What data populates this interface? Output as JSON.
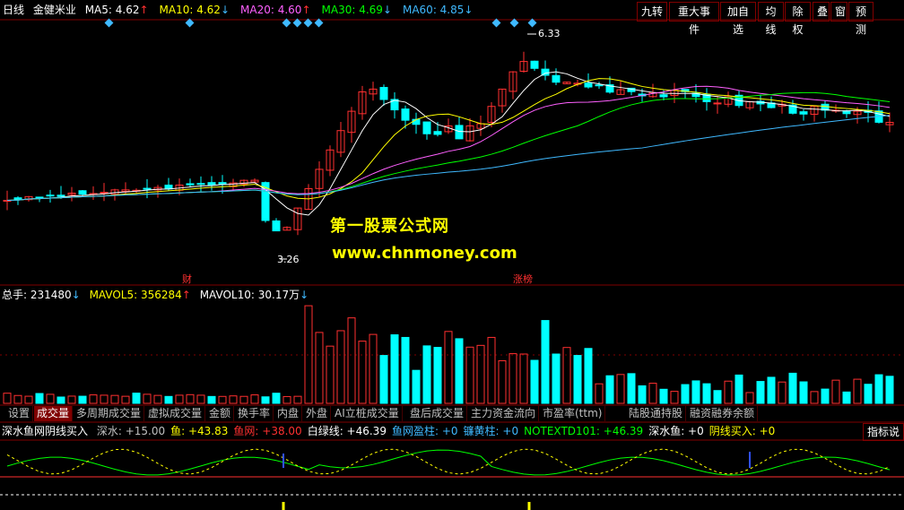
{
  "header": {
    "period": "日线",
    "stock": "金健米业",
    "ma": [
      {
        "label": "MA5: 4.62",
        "arrow": "↑",
        "color": "#ffffff",
        "arrowColor": "#ff3030"
      },
      {
        "label": "MA10: 4.62",
        "arrow": "↓",
        "color": "#ffff00",
        "arrowColor": "#3fb9ff"
      },
      {
        "label": "MA20: 4.60",
        "arrow": "↑",
        "color": "#ff60ff",
        "arrowColor": "#ff3030"
      },
      {
        "label": "MA30: 4.69",
        "arrow": "↓",
        "color": "#00ff00",
        "arrowColor": "#3fb9ff"
      },
      {
        "label": "MA60: 4.85",
        "arrow": "↓",
        "color": "#3fb9ff",
        "arrowColor": "#3fb9ff"
      }
    ]
  },
  "toolbar": {
    "buttons": [
      "九转",
      "重大事件",
      "加自选",
      "均线",
      "除权",
      "叠",
      "窗",
      "预测"
    ]
  },
  "price": {
    "high_label": "6.33",
    "low_label": "3.26",
    "marker_cai": "财",
    "marker_zhang": "涨榜",
    "watermark_title": "第一股票公式网",
    "watermark_url": "www.chnmoney.com"
  },
  "volume": {
    "total_label": "总手: 231480",
    "total_arrow": "↓",
    "mavol5_label": "MAVOL5: 356284",
    "mavol5_arrow": "↑",
    "mavol10_label": "MAVOL10: 30.17万",
    "mavol10_arrow": "↓"
  },
  "tabs": [
    "设置",
    "成交量",
    "多周期成交量",
    "虚拟成交量",
    "金额",
    "换手率",
    "内盘",
    "外盘",
    "AI立桩成交量",
    "盘后成交量",
    "主力资金流向",
    "市盈率(ttm)",
    "陆股通持股",
    "融资融券余额"
  ],
  "indicator": {
    "name": "深水鱼网阴线买入",
    "items": [
      {
        "label": "深水: +15.00",
        "color": "#c0c0c0"
      },
      {
        "label": "鱼: +43.83",
        "color": "#ffff00"
      },
      {
        "label": "鱼网: +38.00",
        "color": "#ff3030"
      },
      {
        "label": "白绿线: +46.39",
        "color": "#ffffff"
      },
      {
        "label": "鱼网盈柱: +0",
        "color": "#3fb9ff"
      },
      {
        "label": "镰黄柱: +0",
        "color": "#3fb9ff"
      },
      {
        "label": "NOTEXTD101: +46.39",
        "color": "#00ff00"
      },
      {
        "label": "深水鱼: +0",
        "color": "#ffffff"
      },
      {
        "label": "阴线买入: +0",
        "color": "#ffff00"
      }
    ],
    "button": "指标说"
  },
  "colors": {
    "up": "#ff3030",
    "down": "#00ffff",
    "frame": "#800000"
  }
}
